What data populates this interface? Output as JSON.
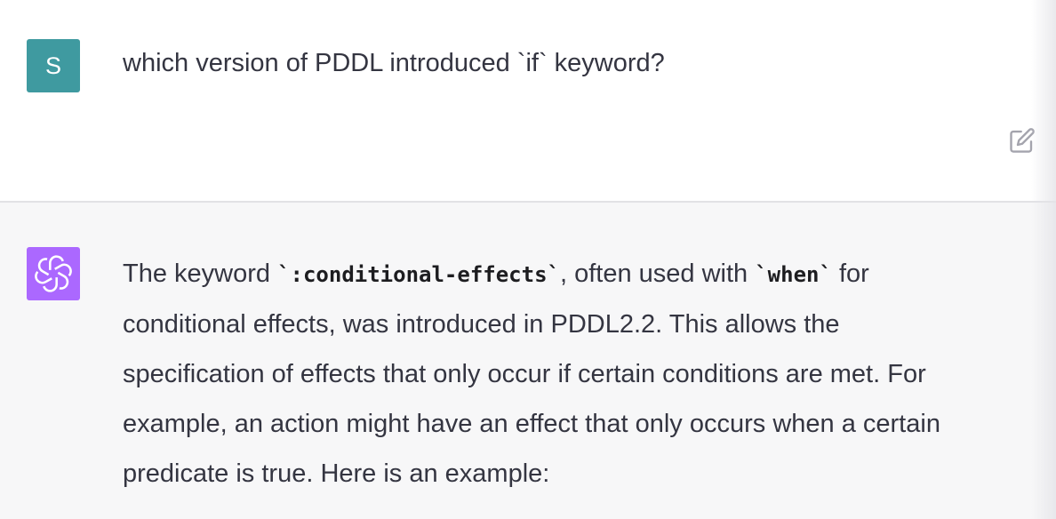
{
  "user_message": {
    "avatar_initial": "S",
    "text": "which version of PDDL introduced `if` keyword?"
  },
  "assistant_message": {
    "lines": [
      {
        "parts": [
          {
            "text": "The keyword ",
            "code": false
          },
          {
            "text": "`:conditional-effects`",
            "code": true
          },
          {
            "text": ", often used with ",
            "code": false
          },
          {
            "text": "`when`",
            "code": true
          },
          {
            "text": " for",
            "code": false
          }
        ]
      },
      {
        "parts": [
          {
            "text": "conditional effects, was introduced in PDDL2.2. This allows the",
            "code": false
          }
        ]
      },
      {
        "parts": [
          {
            "text": "specification of effects that only occur if certain conditions are met. For",
            "code": false
          }
        ]
      },
      {
        "parts": [
          {
            "text": "example, an action might have an effect that only occurs when a certain",
            "code": false
          }
        ]
      },
      {
        "parts": [
          {
            "text": "predicate is true. Here is an example:",
            "code": false
          }
        ]
      }
    ]
  },
  "icons": {
    "edit": "edit-icon",
    "assistant_logo": "openai-logo-icon"
  },
  "colors": {
    "user_avatar": "#3f9aa0",
    "assistant_avatar": "#ab68ff",
    "assistant_background": "#f7f7f8",
    "text": "#343541"
  }
}
